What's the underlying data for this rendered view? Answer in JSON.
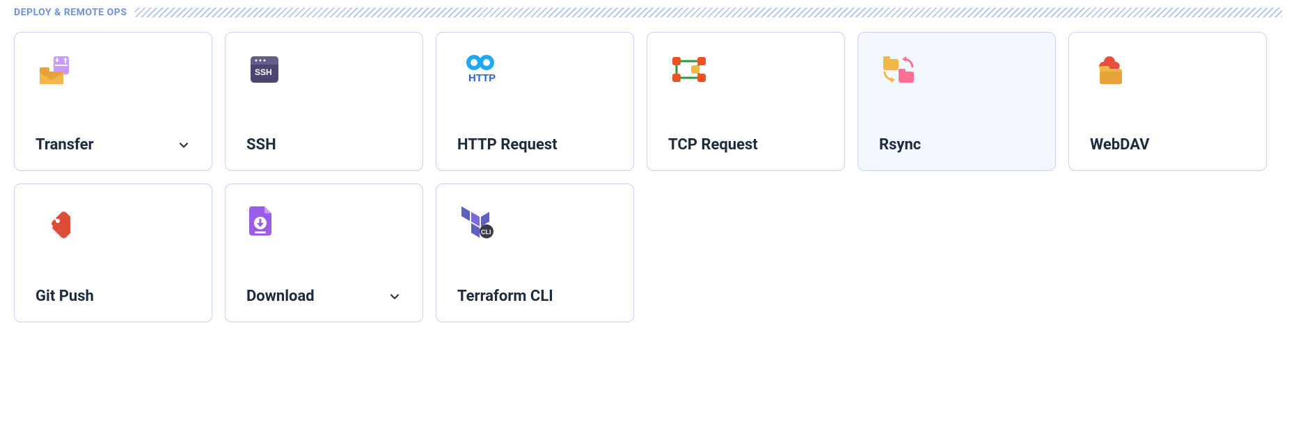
{
  "section": {
    "title": "DEPLOY & REMOTE OPS"
  },
  "cards": [
    {
      "label": "Transfer",
      "icon": "transfer-icon",
      "chevron": true,
      "highlight": false
    },
    {
      "label": "SSH",
      "icon": "ssh-icon",
      "chevron": false,
      "highlight": false
    },
    {
      "label": "HTTP Request",
      "icon": "http-icon",
      "chevron": false,
      "highlight": false
    },
    {
      "label": "TCP Request",
      "icon": "tcp-icon",
      "chevron": false,
      "highlight": false
    },
    {
      "label": "Rsync",
      "icon": "rsync-icon",
      "chevron": false,
      "highlight": true
    },
    {
      "label": "WebDAV",
      "icon": "webdav-icon",
      "chevron": false,
      "highlight": false
    },
    {
      "label": "Git Push",
      "icon": "git-push-icon",
      "chevron": false,
      "highlight": false
    },
    {
      "label": "Download",
      "icon": "download-icon",
      "chevron": true,
      "highlight": false
    },
    {
      "label": "Terraform CLI",
      "icon": "terraform-icon",
      "chevron": false,
      "highlight": false
    }
  ]
}
